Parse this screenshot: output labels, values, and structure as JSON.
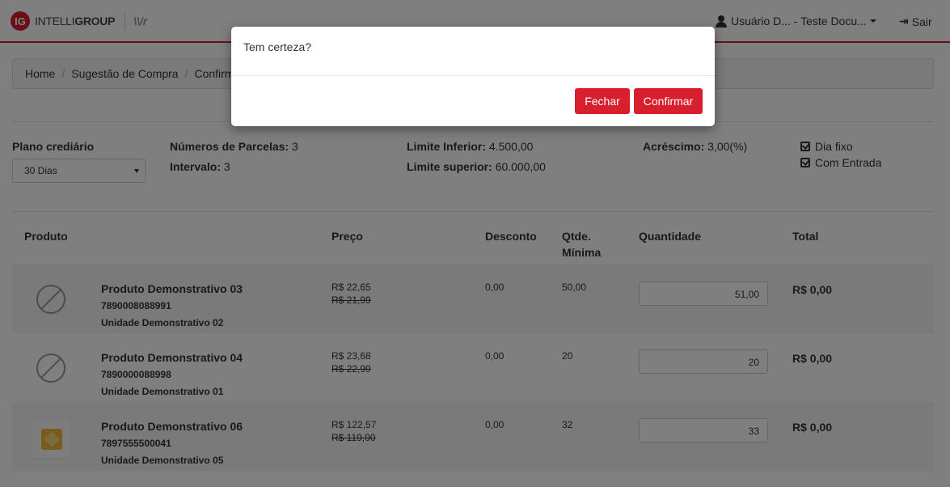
{
  "navbar": {
    "logo_mark": "IG",
    "brand_light": "INTELLI",
    "brand_bold": "GROUP",
    "brand_sub": "\\\\/r",
    "user_label": "Usuário D... - Teste Docu...",
    "logout_label": "Sair",
    "accent_color": "#d71f2e"
  },
  "breadcrumb": [
    "Home",
    "Sugestão de Compra",
    "Confirm"
  ],
  "plan": {
    "label": "Plano crediário",
    "selected": "30 Dias",
    "parcelas_label": "Números de Parcelas:",
    "parcelas_value": "3",
    "intervalo_label": "Intervalo:",
    "intervalo_value": "3",
    "limite_inf_label": "Limite Inferior:",
    "limite_inf_value": "4.500,00",
    "limite_sup_label": "Limite superior:",
    "limite_sup_value": "60.000,00",
    "acrescimo_label": "Acréscimo:",
    "acrescimo_value": "3,00(%)",
    "dia_fixo": "Dia fixo",
    "com_entrada": "Com Entrada"
  },
  "table": {
    "headers": {
      "produto": "Produto",
      "preco": "Preço",
      "desconto": "Desconto",
      "qtde_1": "Qtde.",
      "qtde_2": "Mínima",
      "quantidade": "Quantidade",
      "total": "Total"
    },
    "rows": [
      {
        "name": "Produto Demonstrativo 03",
        "code": "7890008088991",
        "unit": "Unidade Demonstrativo 02",
        "price": "R$ 22,65",
        "old_price": "R$ 21,99",
        "discount": "0,00",
        "min_qty": "50,00",
        "qty": "51,00",
        "total": "R$ 0,00",
        "image": "no-image-icon"
      },
      {
        "name": "Produto Demonstrativo 04",
        "code": "7890000088998",
        "unit": "Unidade Demonstrativo 01",
        "price": "R$ 23,68",
        "old_price": "R$ 22,99",
        "discount": "0,00",
        "min_qty": "20",
        "qty": "20",
        "total": "R$ 0,00",
        "image": "no-image-icon"
      },
      {
        "name": "Produto Demonstrativo 06",
        "code": "7897555500041",
        "unit": "Unidade Demonstrativo 05",
        "price": "R$ 122,57",
        "old_price": "R$ 119,00",
        "discount": "0,00",
        "min_qty": "32",
        "qty": "33",
        "total": "R$ 0,00",
        "image": "product-photo"
      }
    ]
  },
  "modal": {
    "title": "Tem certeza?",
    "close_label": "Fechar",
    "confirm_label": "Confirmar"
  }
}
